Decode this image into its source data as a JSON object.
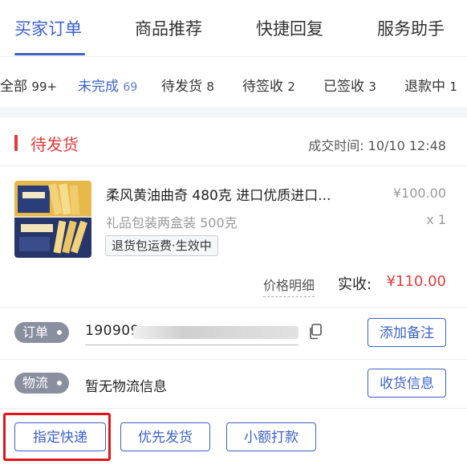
{
  "tabs": [
    {
      "label": "买家订单",
      "active": true
    },
    {
      "label": "商品推荐",
      "active": false
    },
    {
      "label": "快捷回复",
      "active": false
    },
    {
      "label": "服务助手",
      "active": false
    }
  ],
  "filters": [
    {
      "label": "全部",
      "count": "99+",
      "active": false
    },
    {
      "label": "未完成",
      "count": "69",
      "active": true
    },
    {
      "label": "待发货",
      "count": "8",
      "active": false
    },
    {
      "label": "待签收",
      "count": "2",
      "active": false
    },
    {
      "label": "已签收",
      "count": "3",
      "active": false
    },
    {
      "label": "退款中",
      "count": "1",
      "active": false
    }
  ],
  "order": {
    "status": "待发货",
    "deal_time": "成交时间: 10/10 12:48",
    "product": {
      "title": "柔风黄油曲奇 480克 进口优质进口...",
      "price": "¥100.00",
      "spec": "礼品包装两盒装 500克",
      "qty": "x 1",
      "badge": "退货包运费·生效中"
    },
    "price_detail": "价格明细",
    "paid_label": "实收:",
    "paid_value": "¥110.00",
    "order_label": "订单",
    "order_no": "190909",
    "add_note": "添加备注",
    "logistics_label": "物流",
    "logistics_text": "暂无物流信息",
    "receiver_info": "收货信息",
    "actions": {
      "assign_courier": "指定快递",
      "priority_ship": "优先发货",
      "small_payment": "小额打款"
    }
  },
  "colors": {
    "accent": "#3d62c7",
    "alert": "#e23b3b",
    "highlight_box": "#e0151b"
  }
}
